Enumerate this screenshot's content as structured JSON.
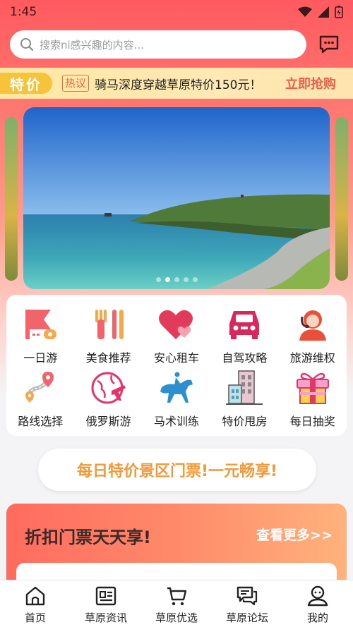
{
  "status": {
    "time": "1:45"
  },
  "search": {
    "placeholder": "搜索ni感兴趣的内容..."
  },
  "promo": {
    "tag": "特价",
    "hot": "热议",
    "text": "骑马深度穿越草原特价150元！",
    "cta": "立即抢购"
  },
  "banner": {
    "pages": 5,
    "active": 1
  },
  "grid": {
    "items": [
      {
        "label": "一日游",
        "icon": "flag-icon"
      },
      {
        "label": "美食推荐",
        "icon": "fork-icon"
      },
      {
        "label": "安心租车",
        "icon": "heart-car-icon"
      },
      {
        "label": "自驾攻略",
        "icon": "car-icon"
      },
      {
        "label": "旅游维权",
        "icon": "support-icon"
      },
      {
        "label": "路线选择",
        "icon": "route-icon"
      },
      {
        "label": "俄罗斯游",
        "icon": "globe-plane-icon"
      },
      {
        "label": "马术训练",
        "icon": "horse-rider-icon"
      },
      {
        "label": "特价甩房",
        "icon": "building-icon"
      },
      {
        "label": "每日抽奖",
        "icon": "gift-icon"
      }
    ]
  },
  "daily": {
    "label": "每日特价景区门票!一元畅享!"
  },
  "discount": {
    "title": "折扣门票天天享!",
    "more": "查看更多>>"
  },
  "tabbar": {
    "items": [
      {
        "label": "首页",
        "icon": "home-icon"
      },
      {
        "label": "草原资讯",
        "icon": "news-icon"
      },
      {
        "label": "草原优选",
        "icon": "cart-icon"
      },
      {
        "label": "草原论坛",
        "icon": "forum-icon"
      },
      {
        "label": "我的",
        "icon": "profile-icon"
      }
    ]
  },
  "colors": {
    "accent": "#ff5a5f",
    "gold": "#f7c33a",
    "orange": "#f29a3a"
  }
}
